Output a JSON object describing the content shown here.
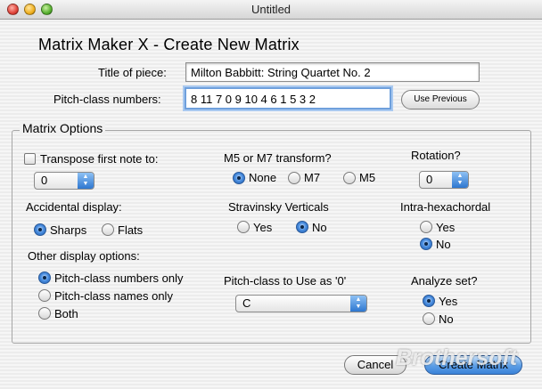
{
  "window": {
    "title": "Untitled"
  },
  "heading": "Matrix Maker X - Create New Matrix",
  "title_field": {
    "label": "Title of piece:",
    "value": "Milton Babbitt: String Quartet No. 2"
  },
  "pcs_field": {
    "label": "Pitch-class numbers:",
    "value": "8 11 7 0 9 10 4 6 1 5 3 2"
  },
  "use_previous_label": "Use Previous",
  "options": {
    "title": "Matrix Options",
    "transpose": {
      "label": "Transpose first note to:",
      "value": "0"
    },
    "m5m7": {
      "label": "M5 or M7 transform?",
      "options": [
        "None",
        "M7",
        "M5"
      ],
      "selected": "None"
    },
    "rotation": {
      "label": "Rotation?",
      "value": "0"
    },
    "accidental": {
      "label": "Accidental display:",
      "options": [
        "Sharps",
        "Flats"
      ],
      "selected": "Sharps"
    },
    "stravinsky": {
      "label": "Stravinsky Verticals",
      "options": [
        "Yes",
        "No"
      ],
      "selected": "No"
    },
    "intrahex": {
      "label": "Intra-hexachordal",
      "options": [
        "Yes",
        "No"
      ],
      "selected": "No"
    },
    "other_display": {
      "label": "Other display options:",
      "options": [
        "Pitch-class numbers only",
        "Pitch-class names only",
        "Both"
      ],
      "selected": "Pitch-class numbers only"
    },
    "pc_zero": {
      "label": "Pitch-class to Use as '0'",
      "value": "C"
    },
    "analyze": {
      "label": "Analyze set?",
      "options": [
        "Yes",
        "No"
      ],
      "selected": "Yes"
    }
  },
  "buttons": {
    "cancel": "Cancel",
    "create": "Create Matrix"
  },
  "watermark": "Brothersoft"
}
